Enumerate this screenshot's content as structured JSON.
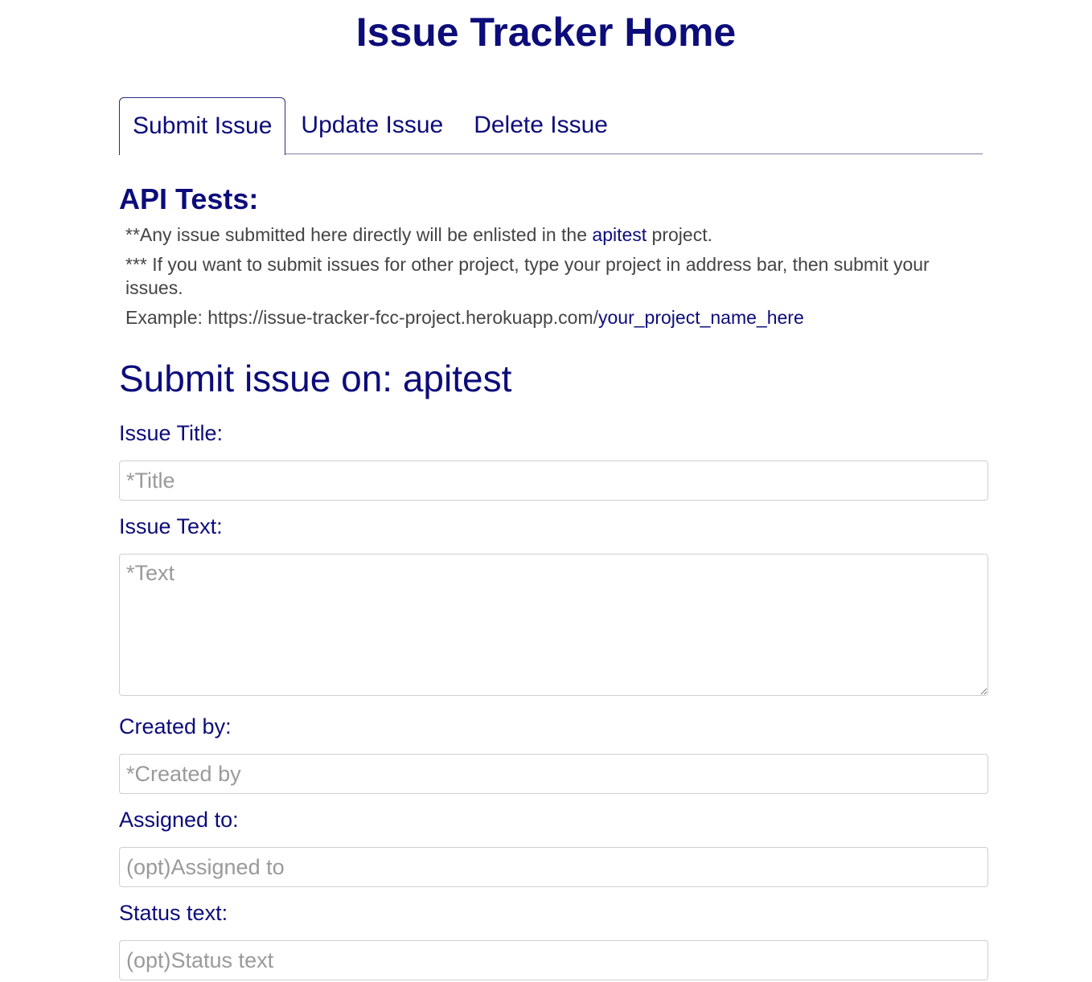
{
  "header": {
    "title": "Issue Tracker Home"
  },
  "tabs": [
    {
      "label": "Submit Issue",
      "active": true
    },
    {
      "label": "Update Issue",
      "active": false
    },
    {
      "label": "Delete Issue",
      "active": false
    }
  ],
  "api": {
    "heading": "API Tests:",
    "note1_prefix": "**Any issue submitted here directly will be enlisted in the ",
    "note1_link": "apitest",
    "note1_suffix": " project.",
    "note2": "*** If you want to submit issues for other project, type your project in address bar, then submit your issues.",
    "note3_prefix": "Example: https://issue-tracker-fcc-project.herokuapp.com/",
    "note3_link": "your_project_name_here"
  },
  "form": {
    "heading": "Submit issue on: apitest",
    "fields": {
      "title": {
        "label": "Issue Title:",
        "placeholder": "*Title",
        "value": ""
      },
      "text": {
        "label": "Issue Text:",
        "placeholder": "*Text",
        "value": ""
      },
      "created_by": {
        "label": "Created by:",
        "placeholder": "*Created by",
        "value": ""
      },
      "assigned_to": {
        "label": "Assigned to:",
        "placeholder": "(opt)Assigned to",
        "value": ""
      },
      "status_text": {
        "label": "Status text:",
        "placeholder": "(opt)Status text",
        "value": ""
      }
    }
  },
  "colors": {
    "accent": "#0c0c7a",
    "body_text": "#444444",
    "placeholder": "#9a9a9a",
    "input_border": "#cfcfcf"
  }
}
